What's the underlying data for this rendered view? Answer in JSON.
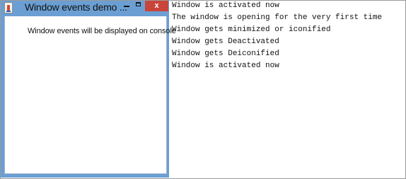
{
  "window": {
    "title": "Window events demo ...",
    "close_glyph": "x",
    "content_label": "Window events will be displayed on console"
  },
  "console": {
    "lines": [
      "Window is activated now",
      "The window is opening for the very first time",
      "Window gets minimized or iconified",
      "Window gets Deactivated",
      "Window gets Deiconified",
      "Window is activated now"
    ]
  },
  "icons": {
    "app": "java-cup-icon",
    "minimize": "minimize-icon",
    "maximize": "maximize-icon",
    "close": "close-icon"
  },
  "colors": {
    "titlebar": "#6b9fd3",
    "close_button": "#c9443a",
    "content_background": "#ffffff"
  }
}
